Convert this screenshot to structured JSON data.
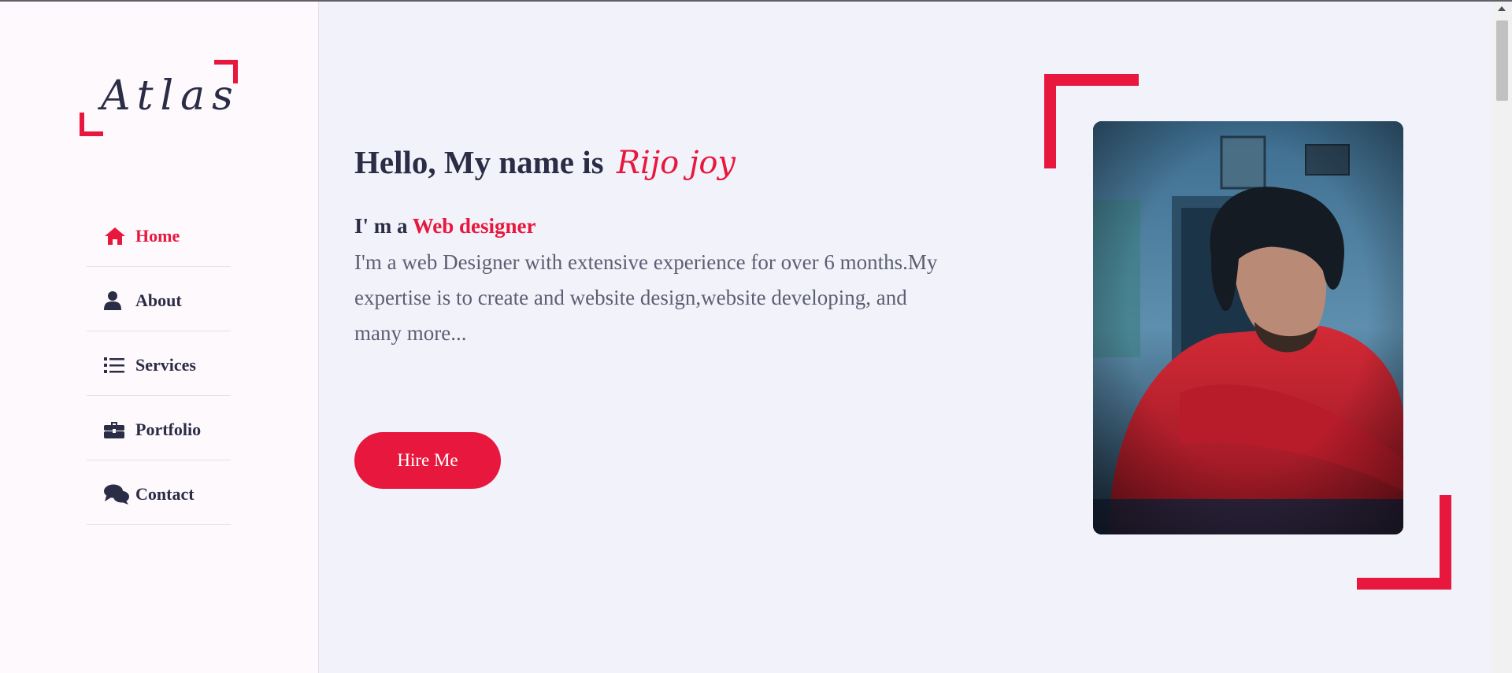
{
  "logo": {
    "text": "Atlas",
    "accent_color": "#e8173d"
  },
  "nav": {
    "items": [
      {
        "label": "Home",
        "icon": "home-icon",
        "active": true
      },
      {
        "label": "About",
        "icon": "user-icon",
        "active": false
      },
      {
        "label": "Services",
        "icon": "list-icon",
        "active": false
      },
      {
        "label": "Portfolio",
        "icon": "briefcase-icon",
        "active": false
      },
      {
        "label": "Contact",
        "icon": "comments-icon",
        "active": false
      }
    ]
  },
  "hero": {
    "greeting": "Hello, My name is",
    "name": "Rijo joy",
    "role_prefix": "I' m a",
    "role": "Web designer",
    "description": "I'm a web Designer with extensive experience for over 6 months.My expertise is to create and website design,website developing, and many more...",
    "cta_label": "Hire Me",
    "photo": "profile-photo"
  },
  "colors": {
    "accent": "#e8173d",
    "text_dark": "#2b2c46",
    "text_muted": "#5d5e72",
    "background": "#f2f3fa",
    "sidebar": "#fdf9fd"
  }
}
